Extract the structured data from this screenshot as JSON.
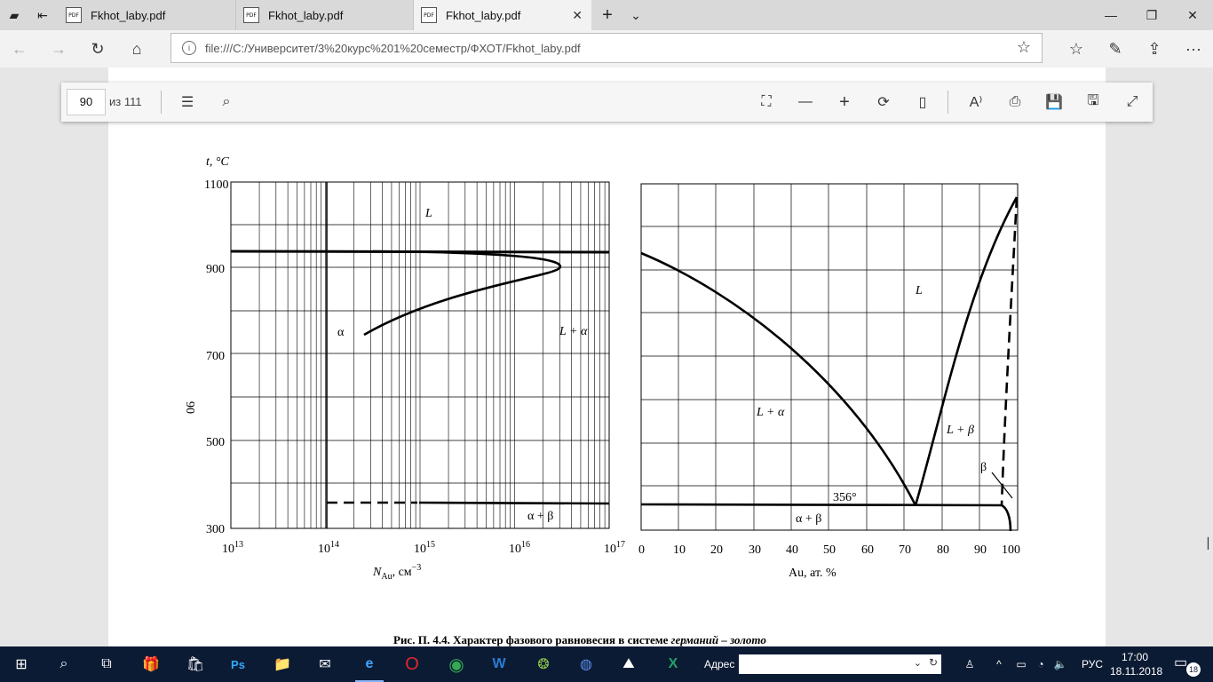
{
  "tabs": [
    {
      "title": "Fkhot_laby.pdf",
      "icon": "pdf-icon"
    },
    {
      "title": "Fkhot_laby.pdf",
      "icon": "pdf-icon"
    },
    {
      "title": "Fkhot_laby.pdf",
      "icon": "pdf-icon",
      "active": true
    }
  ],
  "address_bar": {
    "url": "file:///C:/Университет/3%20курс%201%20семестр/ФХОТ/Fkhot_laby.pdf"
  },
  "pdf_toolbar": {
    "page_number": "90",
    "page_count": "из 111"
  },
  "figure": {
    "left_chart": {
      "y_axis_label": "t, °C",
      "y_ticks": [
        "1100",
        "900",
        "700",
        "500",
        "300"
      ],
      "y_side_label": "06",
      "x_tick_mantissa": "10",
      "x_tick_exponents": [
        "13",
        "14",
        "15",
        "16",
        "17"
      ],
      "x_label_main": "N",
      "x_label_sub": "Au",
      "x_label_unit": ", см",
      "x_label_sup": "−3",
      "region_labels": {
        "L": "L",
        "alpha": "α",
        "L_alpha": "L + α",
        "alpha_beta": "α + β"
      }
    },
    "right_chart": {
      "x_ticks": [
        "0",
        "10",
        "20",
        "30",
        "40",
        "50",
        "60",
        "70",
        "80",
        "90",
        "100"
      ],
      "x_label": "Au, ат. %",
      "region_labels": {
        "L": "L",
        "L_alpha": "L + α",
        "L_beta": "L + β",
        "beta": "β",
        "eutectic": "356°",
        "alpha_beta": "α + β"
      }
    },
    "caption_main": "Рис. П. 4.4. Характер фазового равновесия в системе ",
    "caption_italic": "германий – золото"
  },
  "taskbar": {
    "address_label": "Адрес",
    "language": "РУС",
    "time": "17:00",
    "date": "18.11.2018",
    "notification_count": "18"
  }
}
